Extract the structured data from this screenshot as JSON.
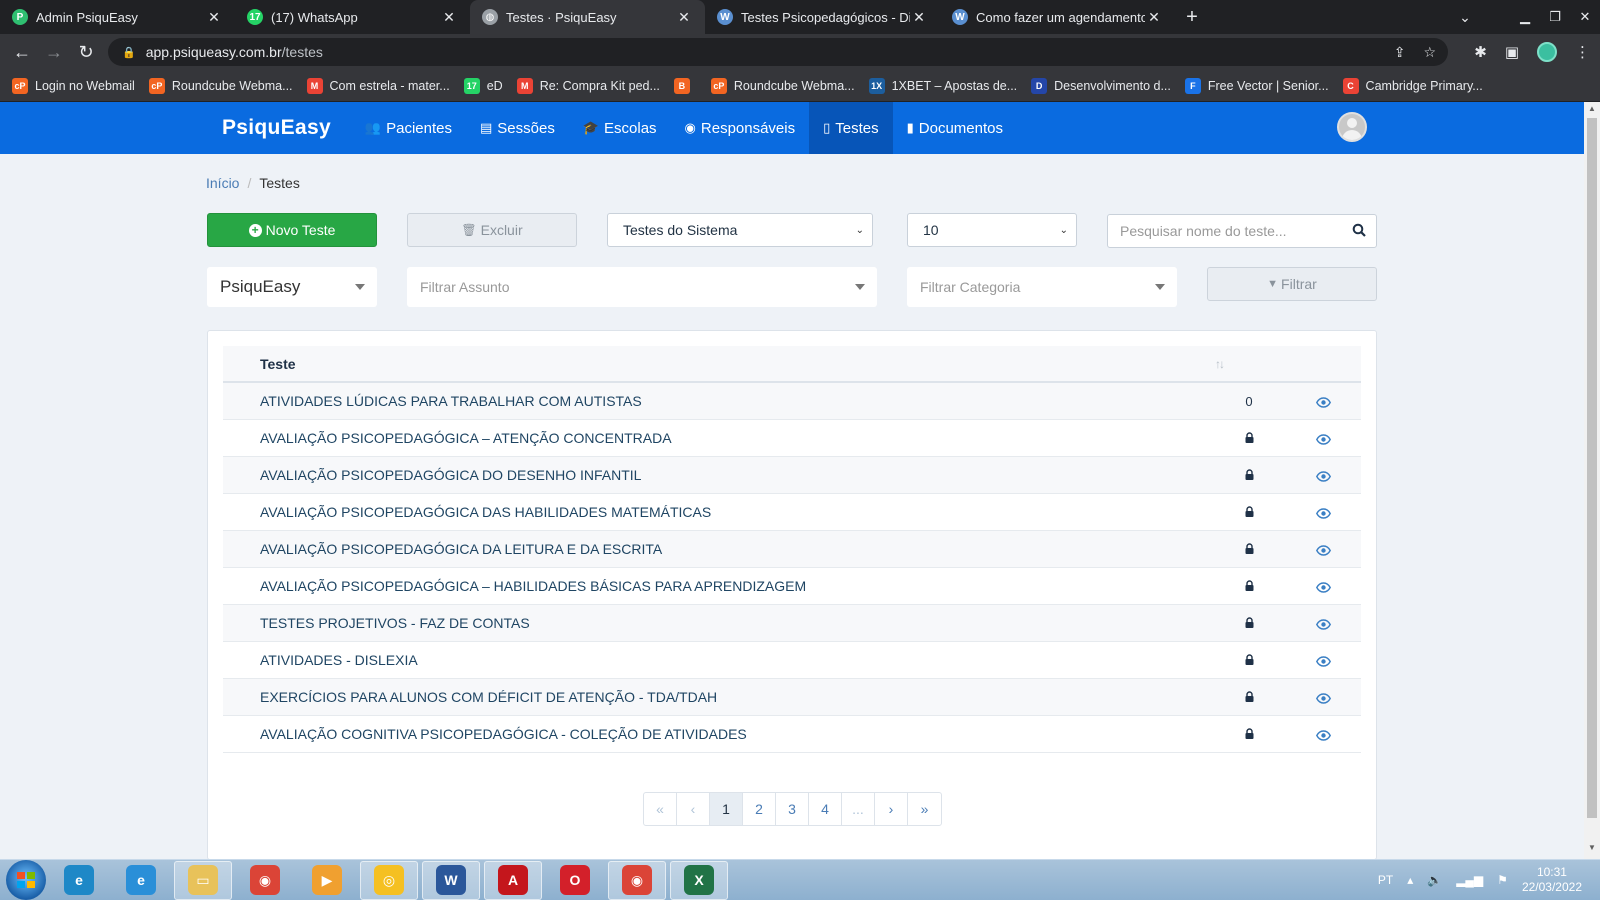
{
  "browser": {
    "tabs": [
      {
        "title": "Admin PsiquEasy",
        "color": "#2fbf71",
        "glyph": "P",
        "active": false
      },
      {
        "title": "(17) WhatsApp",
        "color": "#25d366",
        "glyph": "17",
        "active": false
      },
      {
        "title": "Testes · PsiquEasy",
        "color": "#9aa0a6",
        "glyph": "◍",
        "active": true
      },
      {
        "title": "Testes Psicopedagógicos - Diferen",
        "color": "#5a8fd0",
        "glyph": "W",
        "active": false
      },
      {
        "title": "Como fazer um agendamento no",
        "color": "#5a8fd0",
        "glyph": "W",
        "active": false
      }
    ],
    "url_host": "app.psiqueasy.com.br",
    "url_path": "/testes",
    "bookmarks": [
      {
        "label": "Login no Webmail",
        "color": "#f26522",
        "glyph": "cP"
      },
      {
        "label": "Roundcube Webma...",
        "color": "#f26522",
        "glyph": "cP"
      },
      {
        "label": "Com estrela - mater...",
        "color": "#ea4335",
        "glyph": "M"
      },
      {
        "label": "eD",
        "color": "#25d366",
        "glyph": "17"
      },
      {
        "label": "Re: Compra Kit ped...",
        "color": "#ea4335",
        "glyph": "M"
      },
      {
        "label": "",
        "color": "#f26522",
        "glyph": "B"
      },
      {
        "label": "Roundcube Webma...",
        "color": "#f26522",
        "glyph": "cP"
      },
      {
        "label": "1XBET – Apostas de...",
        "color": "#1c5e9e",
        "glyph": "1X"
      },
      {
        "label": "Desenvolvimento d...",
        "color": "#2446a8",
        "glyph": "D"
      },
      {
        "label": "Free Vector | Senior...",
        "color": "#1a73e8",
        "glyph": "F"
      },
      {
        "label": "Cambridge Primary...",
        "color": "#ea4335",
        "glyph": "C"
      }
    ]
  },
  "app": {
    "brand": "PsiquEasy",
    "nav": [
      {
        "label": "Pacientes",
        "icon": "users-icon",
        "glyph": "👥",
        "active": false
      },
      {
        "label": "Sessões",
        "icon": "card-icon",
        "glyph": "▤",
        "active": false
      },
      {
        "label": "Escolas",
        "icon": "graduation-cap-icon",
        "glyph": "🎓",
        "active": false
      },
      {
        "label": "Responsáveis",
        "icon": "user-circle-icon",
        "glyph": "◉",
        "active": false
      },
      {
        "label": "Testes",
        "icon": "file-icon",
        "glyph": "▯",
        "active": true
      },
      {
        "label": "Documentos",
        "icon": "book-icon",
        "glyph": "▮",
        "active": false
      }
    ]
  },
  "breadcrumb": {
    "home": "Início",
    "current": "Testes"
  },
  "toolbar": {
    "new_label": "Novo Teste",
    "delete_label": "Excluir",
    "source_select": "Testes do Sistema",
    "page_size": "10",
    "search_placeholder": "Pesquisar nome do teste...",
    "owner_select": "PsiquEasy",
    "subject_placeholder": "Filtrar Assunto",
    "category_placeholder": "Filtrar Categoria",
    "filter_label": "Filtrar"
  },
  "table": {
    "header": "Teste",
    "rows": [
      {
        "name": "ATIVIDADES LÚDICAS PARA TRABALHAR COM AUTISTAS",
        "mid": "0",
        "locked": false
      },
      {
        "name": "AVALIAÇÃO PSICOPEDAGÓGICA – ATENÇÃO CONCENTRADA",
        "mid": "",
        "locked": true
      },
      {
        "name": "AVALIAÇÃO PSICOPEDAGÓGICA DO DESENHO INFANTIL",
        "mid": "",
        "locked": true
      },
      {
        "name": "AVALIAÇÃO PSICOPEDAGÓGICA DAS HABILIDADES MATEMÁTICAS",
        "mid": "",
        "locked": true
      },
      {
        "name": "AVALIAÇÃO PSICOPEDAGÓGICA DA LEITURA E DA ESCRITA",
        "mid": "",
        "locked": true
      },
      {
        "name": "AVALIAÇÃO PSICOPEDAGÓGICA – HABILIDADES BÁSICAS PARA APRENDIZAGEM",
        "mid": "",
        "locked": true
      },
      {
        "name": "TESTES PROJETIVOS - FAZ DE CONTAS",
        "mid": "",
        "locked": true
      },
      {
        "name": "ATIVIDADES - DISLEXIA",
        "mid": "",
        "locked": true
      },
      {
        "name": "EXERCÍCIOS PARA ALUNOS COM DÉFICIT DE ATENÇÃO - TDA/TDAH",
        "mid": "",
        "locked": true
      },
      {
        "name": "AVALIAÇÃO COGNITIVA PSICOPEDAGÓGICA - COLEÇÃO DE ATIVIDADES",
        "mid": "",
        "locked": true
      }
    ]
  },
  "pagination": {
    "items": [
      {
        "label": "«",
        "state": "dis"
      },
      {
        "label": "‹",
        "state": "dis"
      },
      {
        "label": "1",
        "state": "active"
      },
      {
        "label": "2",
        "state": ""
      },
      {
        "label": "3",
        "state": ""
      },
      {
        "label": "4",
        "state": ""
      },
      {
        "label": "...",
        "state": "dis"
      },
      {
        "label": "›",
        "state": ""
      },
      {
        "label": "»",
        "state": ""
      }
    ]
  },
  "taskbar": {
    "apps": [
      {
        "name": "edge-icon",
        "color": "#1e88c7",
        "glyph": "e",
        "boxed": false
      },
      {
        "name": "internet-explorer-icon",
        "color": "#2a8fd8",
        "glyph": "e",
        "boxed": false
      },
      {
        "name": "file-explorer-icon",
        "color": "#e8c25a",
        "glyph": "▭",
        "boxed": true
      },
      {
        "name": "chrome-icon",
        "color": "#db4437",
        "glyph": "◉",
        "boxed": false
      },
      {
        "name": "media-player-icon",
        "color": "#f0a030",
        "glyph": "▶",
        "boxed": false
      },
      {
        "name": "vpn-icon",
        "color": "#f5c022",
        "glyph": "◎",
        "boxed": true
      },
      {
        "name": "word-icon",
        "color": "#2b579a",
        "glyph": "W",
        "boxed": true
      },
      {
        "name": "acrobat-icon",
        "color": "#c4161c",
        "glyph": "A",
        "boxed": true
      },
      {
        "name": "opera-icon",
        "color": "#d3202a",
        "glyph": "O",
        "boxed": false
      },
      {
        "name": "chrome-active-icon",
        "color": "#db4437",
        "glyph": "◉",
        "boxed": true
      },
      {
        "name": "excel-icon",
        "color": "#217346",
        "glyph": "X",
        "boxed": true
      }
    ],
    "lang": "PT",
    "time": "10:31",
    "date": "22/03/2022"
  }
}
